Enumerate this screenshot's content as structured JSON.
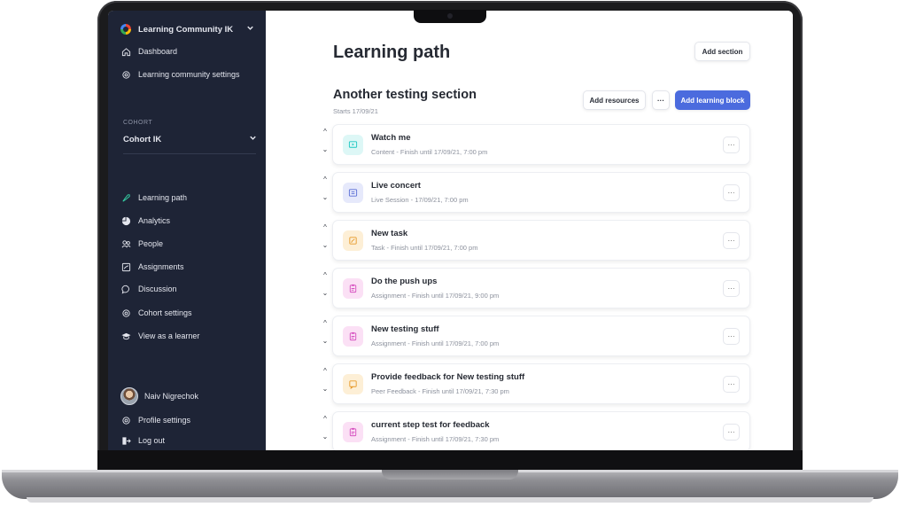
{
  "sidebar": {
    "org_name": "Learning Community IK",
    "top_items": [
      {
        "label": "Dashboard",
        "icon": "home-icon"
      },
      {
        "label": "Learning community settings",
        "icon": "gear-icon"
      }
    ],
    "cohort_label": "COHORT",
    "cohort_name": "Cohort IK",
    "nav_items": [
      {
        "label": "Learning path",
        "icon": "rocket-icon",
        "active": true
      },
      {
        "label": "Analytics",
        "icon": "pie-chart-icon"
      },
      {
        "label": "People",
        "icon": "people-icon"
      },
      {
        "label": "Assignments",
        "icon": "assignment-icon"
      },
      {
        "label": "Discussion",
        "icon": "chat-icon"
      },
      {
        "label": "Cohort settings",
        "icon": "gear-icon"
      },
      {
        "label": "View as a learner",
        "icon": "graduation-cap-icon"
      }
    ],
    "user_name": "Naiv Nigrechok",
    "bottom_items": [
      {
        "label": "Profile settings",
        "icon": "gear-icon"
      },
      {
        "label": "Log out",
        "icon": "logout-icon"
      }
    ]
  },
  "main": {
    "page_title": "Learning path",
    "add_section_label": "Add section",
    "section": {
      "title": "Another testing section",
      "subtitle": "Starts 17/09/21",
      "add_resources_label": "Add resources",
      "more_label": "···",
      "add_block_label": "Add learning block"
    },
    "blocks": [
      {
        "title": "Watch me",
        "meta": "Content - Finish until  17/09/21, 7:00 pm",
        "icon": "video-icon",
        "color": "#1cc7c1",
        "bg": "#ddf7f6"
      },
      {
        "title": "Live concert",
        "meta": "Live Session  -  17/09/21, 7:00 pm",
        "icon": "live-session-icon",
        "color": "#5b6fd6",
        "bg": "#e6e9fb"
      },
      {
        "title": "New task",
        "meta": "Task - Finish until  17/09/21, 7:00 pm",
        "icon": "task-icon",
        "color": "#e79a2b",
        "bg": "#fdefd6"
      },
      {
        "title": "Do the push ups",
        "meta": "Assignment - Finish until  17/09/21, 9:00 pm",
        "icon": "assignment-icon",
        "color": "#d64fc0",
        "bg": "#fbe0f5"
      },
      {
        "title": "New testing stuff",
        "meta": "Assignment - Finish until  17/09/21, 7:00 pm",
        "icon": "assignment-icon",
        "color": "#d64fc0",
        "bg": "#fbe0f5"
      },
      {
        "title": "Provide feedback for New testing stuff",
        "meta": "Peer Feedback - Finish until  17/09/21, 7:30 pm",
        "icon": "feedback-icon",
        "color": "#e79a2b",
        "bg": "#fdefd6"
      },
      {
        "title": "current step test for feedback",
        "meta": "Assignment - Finish until  17/09/21, 7:30 pm",
        "icon": "assignment-icon",
        "color": "#d64fc0",
        "bg": "#fbe0f5"
      }
    ],
    "up_arrow": "^",
    "down_arrow": "⌄",
    "card_more_label": "···"
  }
}
